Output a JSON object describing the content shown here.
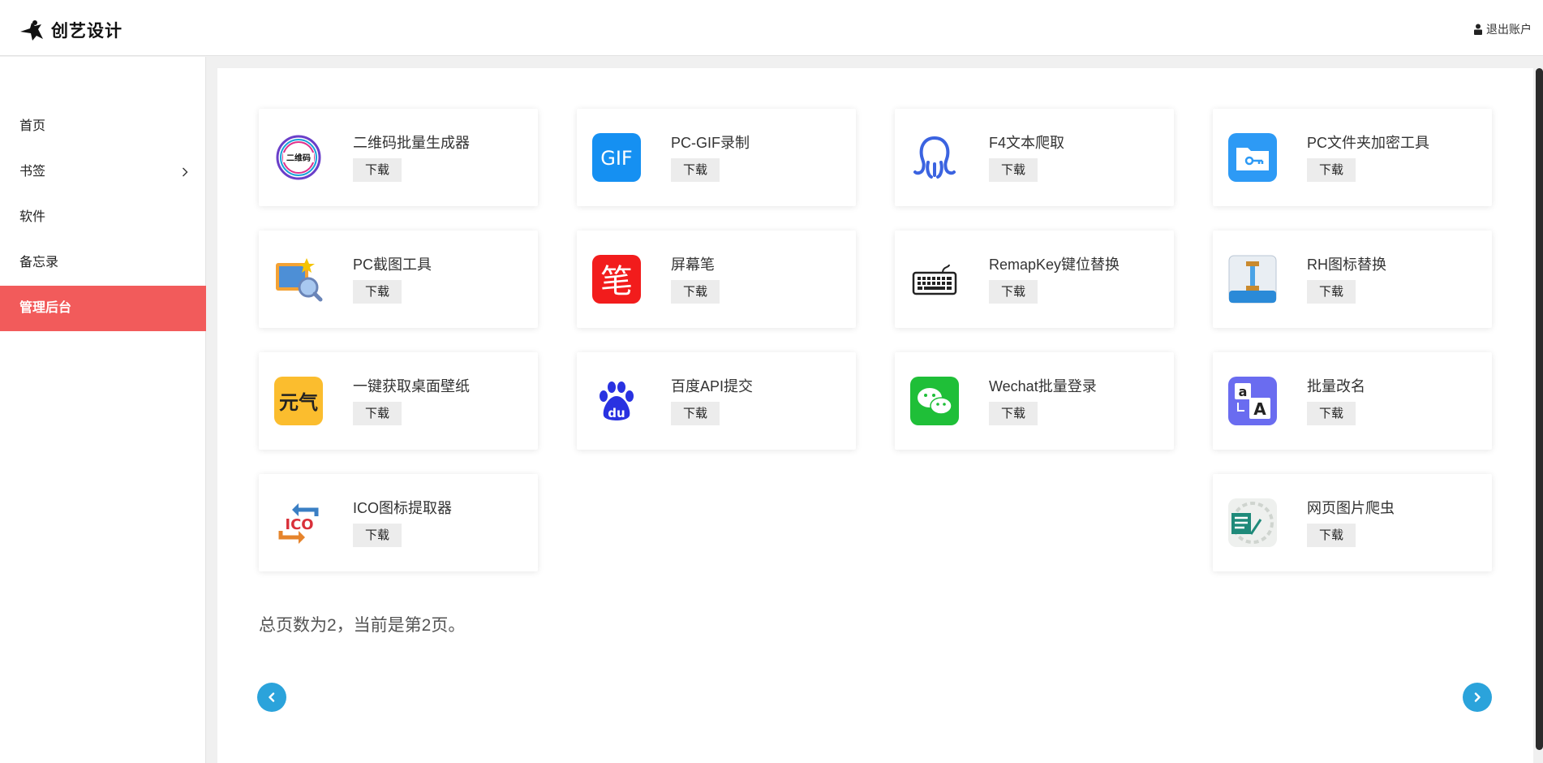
{
  "brand": {
    "name": "创艺设计"
  },
  "header": {
    "logout_label": "退出账户"
  },
  "sidebar": {
    "items": [
      {
        "label": "首页"
      },
      {
        "label": "书签"
      },
      {
        "label": "软件"
      },
      {
        "label": "备忘录"
      },
      {
        "label": "管理后台"
      }
    ]
  },
  "software": {
    "download_label": "下载",
    "items": [
      {
        "title": "二维码批量生成器",
        "icon": "qrcode-generator-icon"
      },
      {
        "title": "PC-GIF录制",
        "icon": "gif-icon"
      },
      {
        "title": "F4文本爬取",
        "icon": "octopus-icon"
      },
      {
        "title": "PC文件夹加密工具",
        "icon": "folder-key-icon"
      },
      {
        "title": "PC截图工具",
        "icon": "screenshot-icon"
      },
      {
        "title": "屏幕笔",
        "icon": "pen-icon"
      },
      {
        "title": "RemapKey键位替换",
        "icon": "keyboard-icon"
      },
      {
        "title": "RH图标替换",
        "icon": "resource-hacker-icon"
      },
      {
        "title": "一键获取桌面壁纸",
        "icon": "wallpaper-icon"
      },
      {
        "title": "百度API提交",
        "icon": "baidu-icon"
      },
      {
        "title": "Wechat批量登录",
        "icon": "wechat-icon"
      },
      {
        "title": "批量改名",
        "icon": "rename-icon"
      },
      {
        "title": "ICO图标提取器",
        "icon": "ico-extractor-icon"
      },
      {
        "title": "网页图片爬虫",
        "icon": "image-crawler-icon"
      }
    ]
  },
  "pagination": {
    "info": "总页数为2，当前是第2页。",
    "accent": "#2ba3db"
  },
  "colors": {
    "active_nav": "#f25b5b"
  }
}
